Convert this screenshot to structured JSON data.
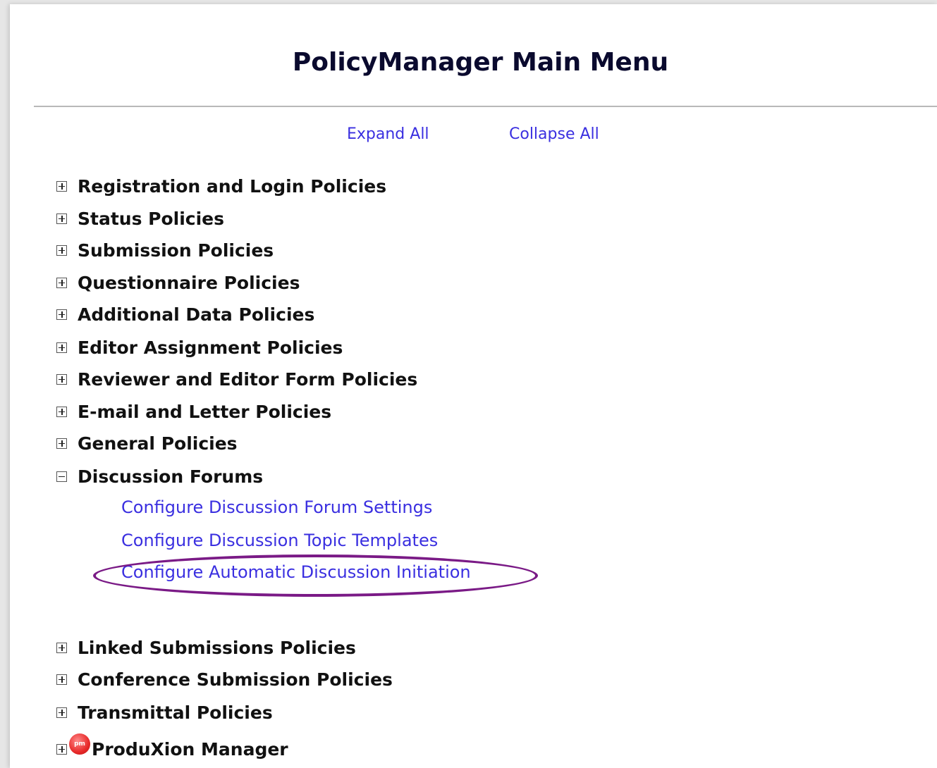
{
  "page": {
    "title": "PolicyManager Main Menu"
  },
  "controls": {
    "expand_all": "Expand All",
    "collapse_all": "Collapse All"
  },
  "menu": {
    "items": [
      {
        "label": "Registration and Login Policies",
        "state": "collapsed"
      },
      {
        "label": "Status Policies",
        "state": "collapsed"
      },
      {
        "label": "Submission Policies",
        "state": "collapsed"
      },
      {
        "label": "Questionnaire Policies",
        "state": "collapsed"
      },
      {
        "label": "Additional Data Policies",
        "state": "collapsed"
      },
      {
        "label": "Editor Assignment Policies",
        "state": "collapsed"
      },
      {
        "label": "Reviewer and Editor Form Policies",
        "state": "collapsed"
      },
      {
        "label": "E-mail and Letter Policies",
        "state": "collapsed"
      },
      {
        "label": "General Policies",
        "state": "collapsed"
      },
      {
        "label": "Discussion Forums",
        "state": "expanded"
      },
      {
        "label": "Linked Submissions Policies",
        "state": "collapsed"
      },
      {
        "label": "Conference Submission Policies",
        "state": "collapsed"
      },
      {
        "label": "Transmittal Policies",
        "state": "collapsed"
      },
      {
        "label": "ProduXion Manager",
        "state": "collapsed",
        "badge": "pm"
      }
    ],
    "discussion_links": [
      "Configure Discussion Forum Settings",
      "Configure Discussion Topic Templates",
      "Configure Automatic Discussion Initiation"
    ]
  },
  "colors": {
    "link": "#3a2fe0",
    "highlight": "#7a1a86",
    "heading": "#0a0a2e"
  }
}
